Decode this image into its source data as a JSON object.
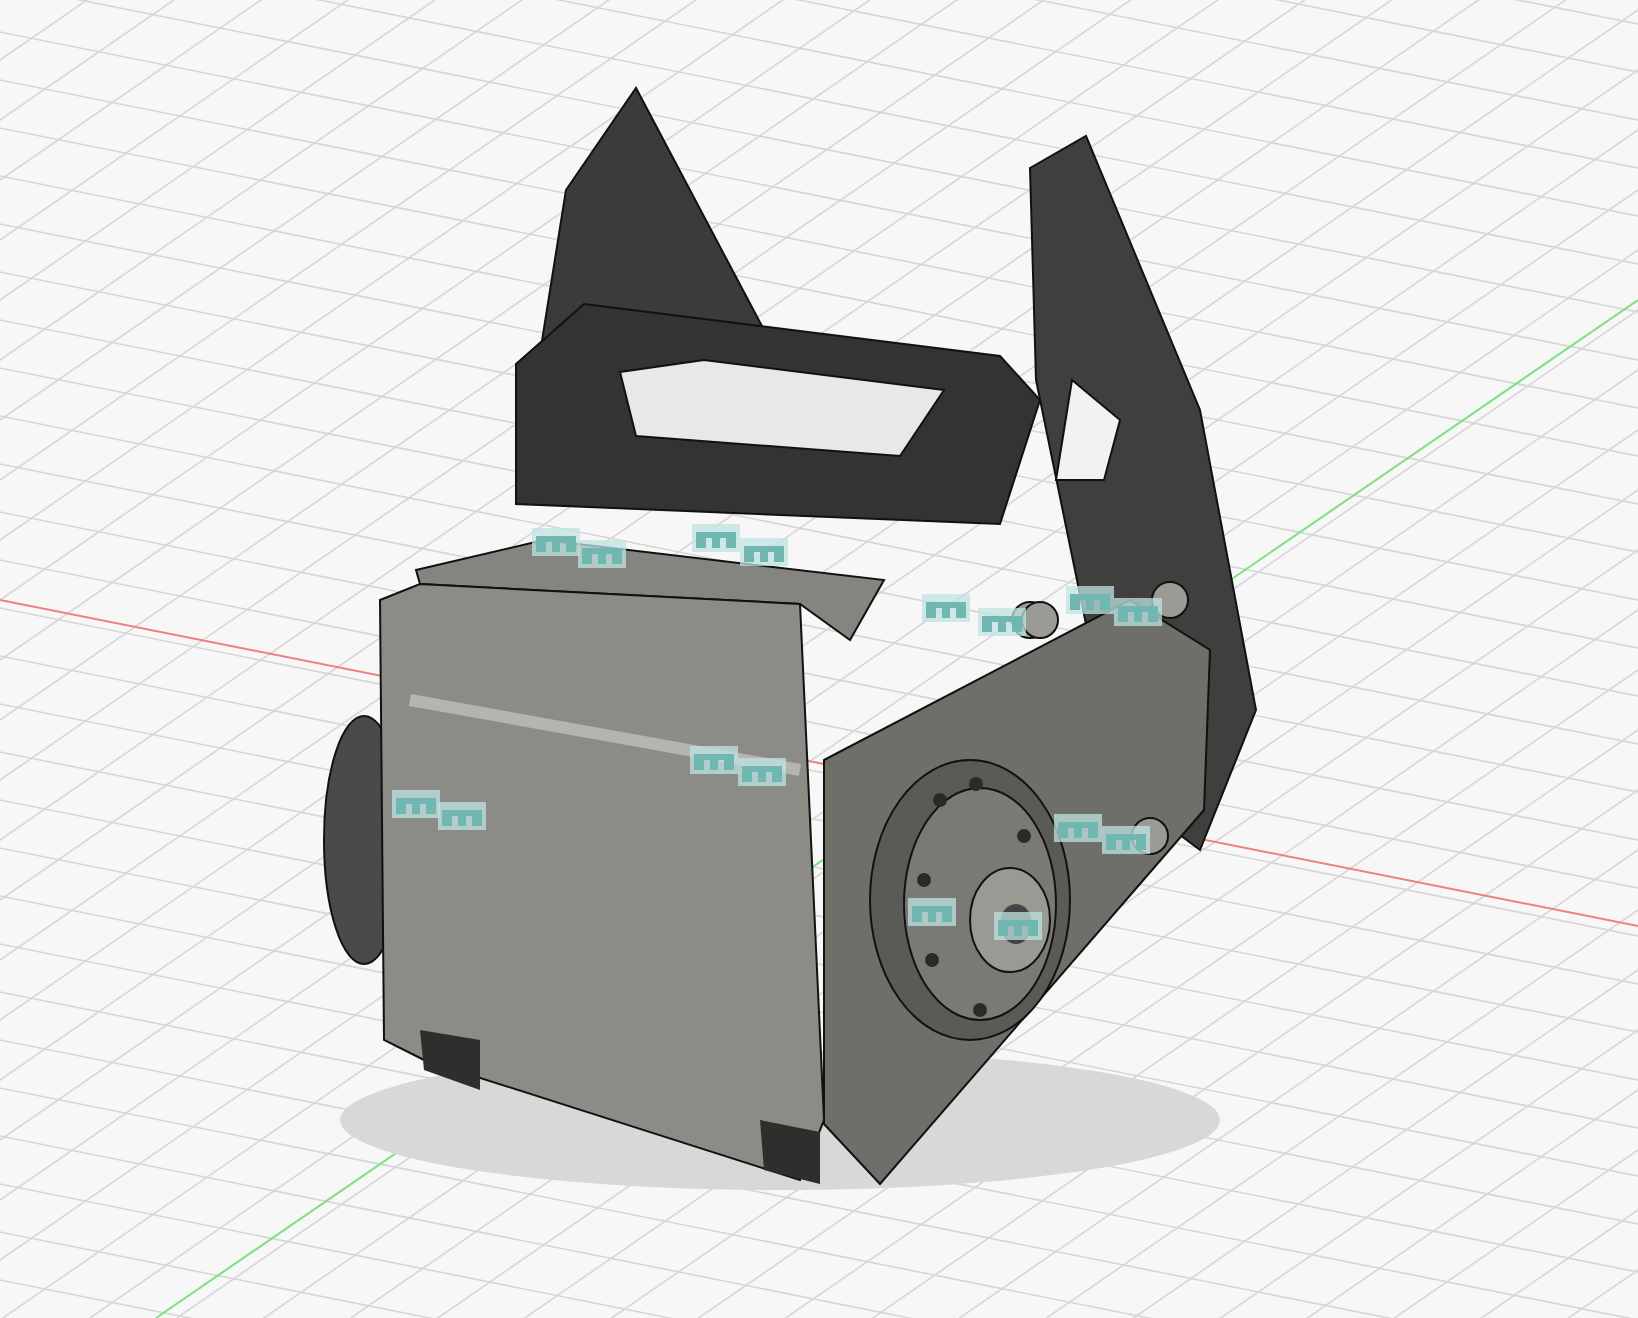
{
  "viewport": {
    "grid": true,
    "axes": true,
    "joints_visible": true
  }
}
